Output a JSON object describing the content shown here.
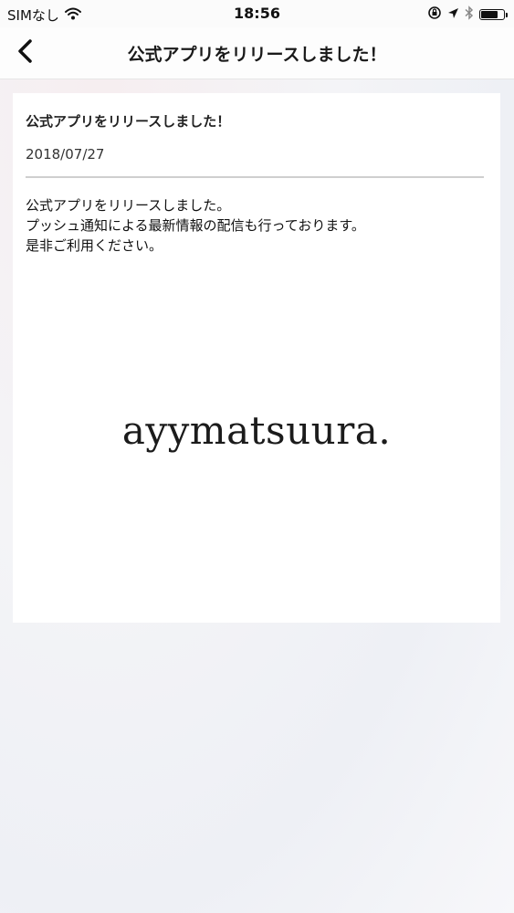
{
  "status_bar": {
    "carrier": "SIMなし",
    "time": "18:56",
    "icons": [
      "wifi-icon",
      "orientation-lock-icon",
      "location-icon",
      "bluetooth-icon",
      "battery-icon"
    ]
  },
  "nav": {
    "back_icon": "chevron-left-icon",
    "title": "公式アプリをリリースしました！"
  },
  "article": {
    "title": "公式アプリをリリースしました！",
    "date": "2018/07/27",
    "body_lines": [
      "公式アプリをリリースしました。",
      "プッシュ通知による最新情報の配信も行っております。",
      "是非ご利用ください。"
    ],
    "logo_text": "ayymatsuura."
  }
}
